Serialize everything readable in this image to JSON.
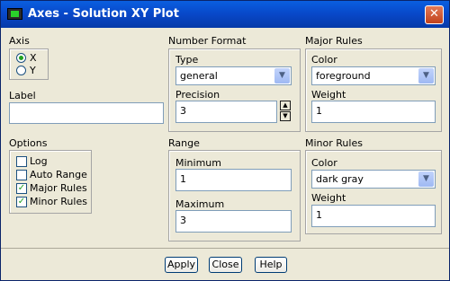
{
  "window": {
    "title": "Axes - Solution XY Plot",
    "close_glyph": "✕"
  },
  "axis": {
    "heading": "Axis",
    "options": [
      "X",
      "Y"
    ],
    "selected": "X"
  },
  "label": {
    "heading": "Label",
    "value": ""
  },
  "options": {
    "heading": "Options",
    "items": [
      {
        "label": "Log",
        "checked": false
      },
      {
        "label": "Auto Range",
        "checked": false
      },
      {
        "label": "Major Rules",
        "checked": true
      },
      {
        "label": "Minor Rules",
        "checked": true
      }
    ],
    "check_glyph": "✓"
  },
  "number_format": {
    "heading": "Number Format",
    "type_label": "Type",
    "type_value": "general",
    "precision_label": "Precision",
    "precision_value": "3"
  },
  "range": {
    "heading": "Range",
    "minimum_label": "Minimum",
    "minimum_value": "1",
    "maximum_label": "Maximum",
    "maximum_value": "3"
  },
  "major_rules": {
    "heading": "Major Rules",
    "color_label": "Color",
    "color_value": "foreground",
    "weight_label": "Weight",
    "weight_value": "1"
  },
  "minor_rules": {
    "heading": "Minor Rules",
    "color_label": "Color",
    "color_value": "dark gray",
    "weight_label": "Weight",
    "weight_value": "1"
  },
  "buttons": {
    "apply": "Apply",
    "close": "Close",
    "help": "Help"
  },
  "glyphs": {
    "dropdown": "▼",
    "spin_up": "▲",
    "spin_down": "▼"
  }
}
